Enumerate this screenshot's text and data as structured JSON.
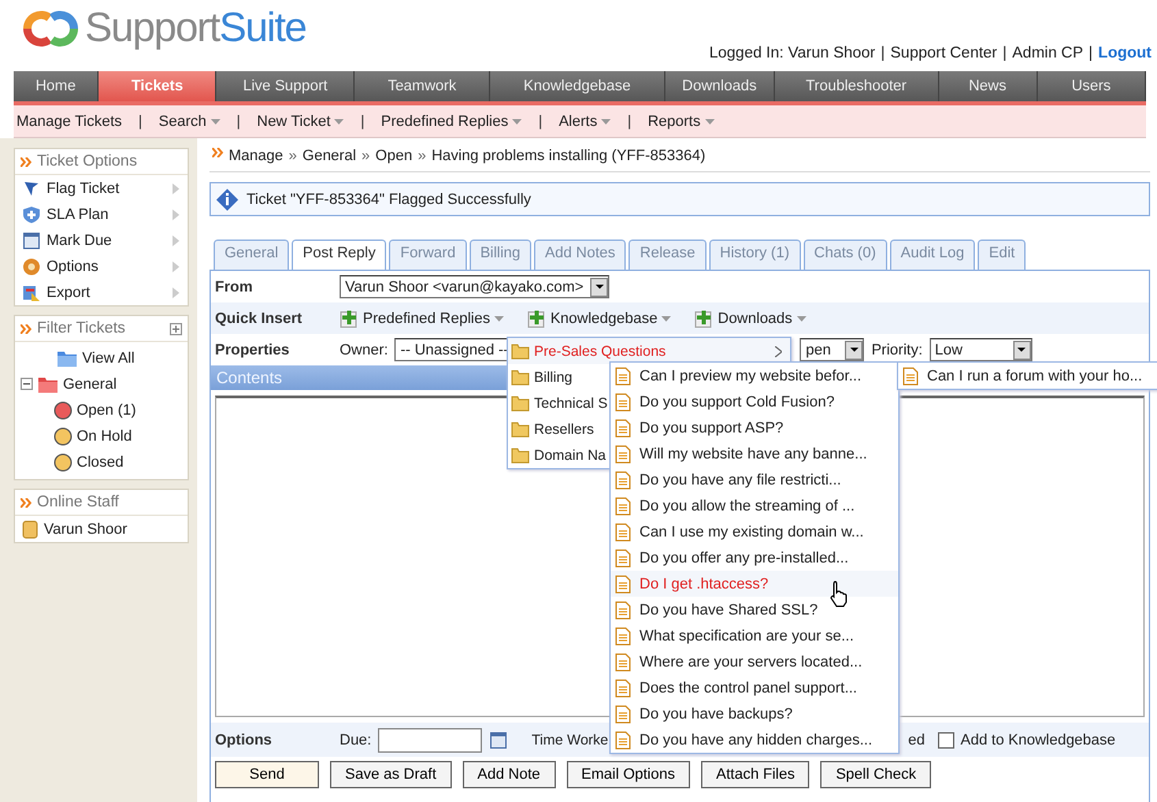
{
  "logo": {
    "text_1": "Support",
    "text_2": "Suite"
  },
  "user_bar": {
    "label": "Logged In: Varun Shoor",
    "separator": "|",
    "links": [
      {
        "label": "Support Center",
        "highlighted": false
      },
      {
        "label": "Admin CP",
        "highlighted": false
      },
      {
        "label": "Logout",
        "highlighted": true
      }
    ]
  },
  "nav": [
    {
      "label": "Home",
      "selected": false
    },
    {
      "label": "Tickets",
      "selected": true
    },
    {
      "label": "Live Support",
      "selected": false
    },
    {
      "label": "Teamwork",
      "selected": false
    },
    {
      "label": "Knowledgebase",
      "selected": false
    },
    {
      "label": "Downloads",
      "selected": false
    },
    {
      "label": "Troubleshooter",
      "selected": false
    },
    {
      "label": "News",
      "selected": false
    },
    {
      "label": "Users",
      "selected": false
    }
  ],
  "subnav": {
    "separator": "|",
    "items": [
      {
        "label": "Manage Tickets",
        "has_menu": false
      },
      {
        "label": "Search",
        "has_menu": true
      },
      {
        "label": "New Ticket",
        "has_menu": true
      },
      {
        "label": "Predefined Replies",
        "has_menu": true
      },
      {
        "label": "Alerts",
        "has_menu": true
      },
      {
        "label": "Reports",
        "has_menu": true
      }
    ]
  },
  "ticket_options": {
    "title": "Ticket Options",
    "items": [
      "Flag Ticket",
      "SLA Plan",
      "Mark Due",
      "Options",
      "Export"
    ]
  },
  "filter_tickets": {
    "title": "Filter Tickets",
    "tree": [
      {
        "label": "View All",
        "expanded": false
      },
      {
        "label": "General",
        "expanded": true,
        "children": [
          {
            "label": "Open (1)",
            "color": "#e85a5a"
          },
          {
            "label": "On Hold",
            "color": "#f3c460"
          },
          {
            "label": "Closed",
            "color": "#f3c460"
          }
        ]
      }
    ]
  },
  "online_staff": {
    "title": "Online Staff",
    "items": [
      "Varun Shoor"
    ]
  },
  "breadcrumb": {
    "separator": "»",
    "items": [
      "Manage",
      "General",
      "Open",
      "Having problems installing (YFF-853364)"
    ]
  },
  "notice": "Ticket \"YFF-853364\" Flagged Successfully",
  "tabs": [
    {
      "label": "General",
      "selected": false
    },
    {
      "label": "Post Reply",
      "selected": true
    },
    {
      "label": "Forward",
      "selected": false
    },
    {
      "label": "Billing",
      "selected": false
    },
    {
      "label": "Add Notes",
      "selected": false
    },
    {
      "label": "Release",
      "selected": false
    },
    {
      "label": "History (1)",
      "selected": false
    },
    {
      "label": "Chats (0)",
      "selected": false
    },
    {
      "label": "Audit Log",
      "selected": false
    },
    {
      "label": "Edit",
      "selected": false
    }
  ],
  "form": {
    "from": {
      "label": "From",
      "value": "Varun Shoor <varun@kayako.com>"
    },
    "quick_insert": {
      "label": "Quick Insert",
      "buttons": [
        "Predefined Replies",
        "Knowledgebase",
        "Downloads"
      ]
    },
    "properties": {
      "label": "Properties",
      "owner_label": "Owner:",
      "owner_value": "-- Unassigned --",
      "status_value": "pen",
      "priority_label": "Priority:",
      "priority_value": "Low"
    },
    "contents_label": "Contents",
    "options": {
      "label": "Options",
      "due_label": "Due:",
      "time_label": "Time Worke",
      "billed_fragment": "ed",
      "kb_checkbox": {
        "label": "Add to Knowledgebase",
        "checked": false
      }
    },
    "actions": [
      "Send",
      "Save as Draft",
      "Add Note",
      "Email Options",
      "Attach Files",
      "Spell Check"
    ]
  },
  "kb_menu": {
    "categories": [
      {
        "label": "Pre-Sales Questions",
        "selected": true
      },
      {
        "label": "Billing",
        "selected": false
      },
      {
        "label": "Technical S",
        "selected": false
      },
      {
        "label": "Resellers",
        "selected": false
      },
      {
        "label": "Domain Na",
        "selected": false
      }
    ],
    "articles": [
      {
        "label": "Can I preview my website befor...",
        "selected": false
      },
      {
        "label": "Do you support Cold Fusion?",
        "selected": false
      },
      {
        "label": "Do you support ASP?",
        "selected": false
      },
      {
        "label": "Will my website have any banne...",
        "selected": false
      },
      {
        "label": "Do you have any file restricti...",
        "selected": false
      },
      {
        "label": "Do you allow the streaming of ...",
        "selected": false
      },
      {
        "label": "Can I use my existing domain w...",
        "selected": false
      },
      {
        "label": "Do you offer any pre-installed...",
        "selected": false
      },
      {
        "label": "Do I get .htaccess?",
        "selected": true
      },
      {
        "label": "Do you have Shared SSL?",
        "selected": false
      },
      {
        "label": "What specification are your se...",
        "selected": false
      },
      {
        "label": "Where are your servers located...",
        "selected": false
      },
      {
        "label": "Does the control panel support...",
        "selected": false
      },
      {
        "label": "Do you have backups?",
        "selected": false
      },
      {
        "label": "Do you have any hidden charges...",
        "selected": false
      }
    ],
    "more_articles": [
      "Can I run a forum with your ho..."
    ]
  }
}
